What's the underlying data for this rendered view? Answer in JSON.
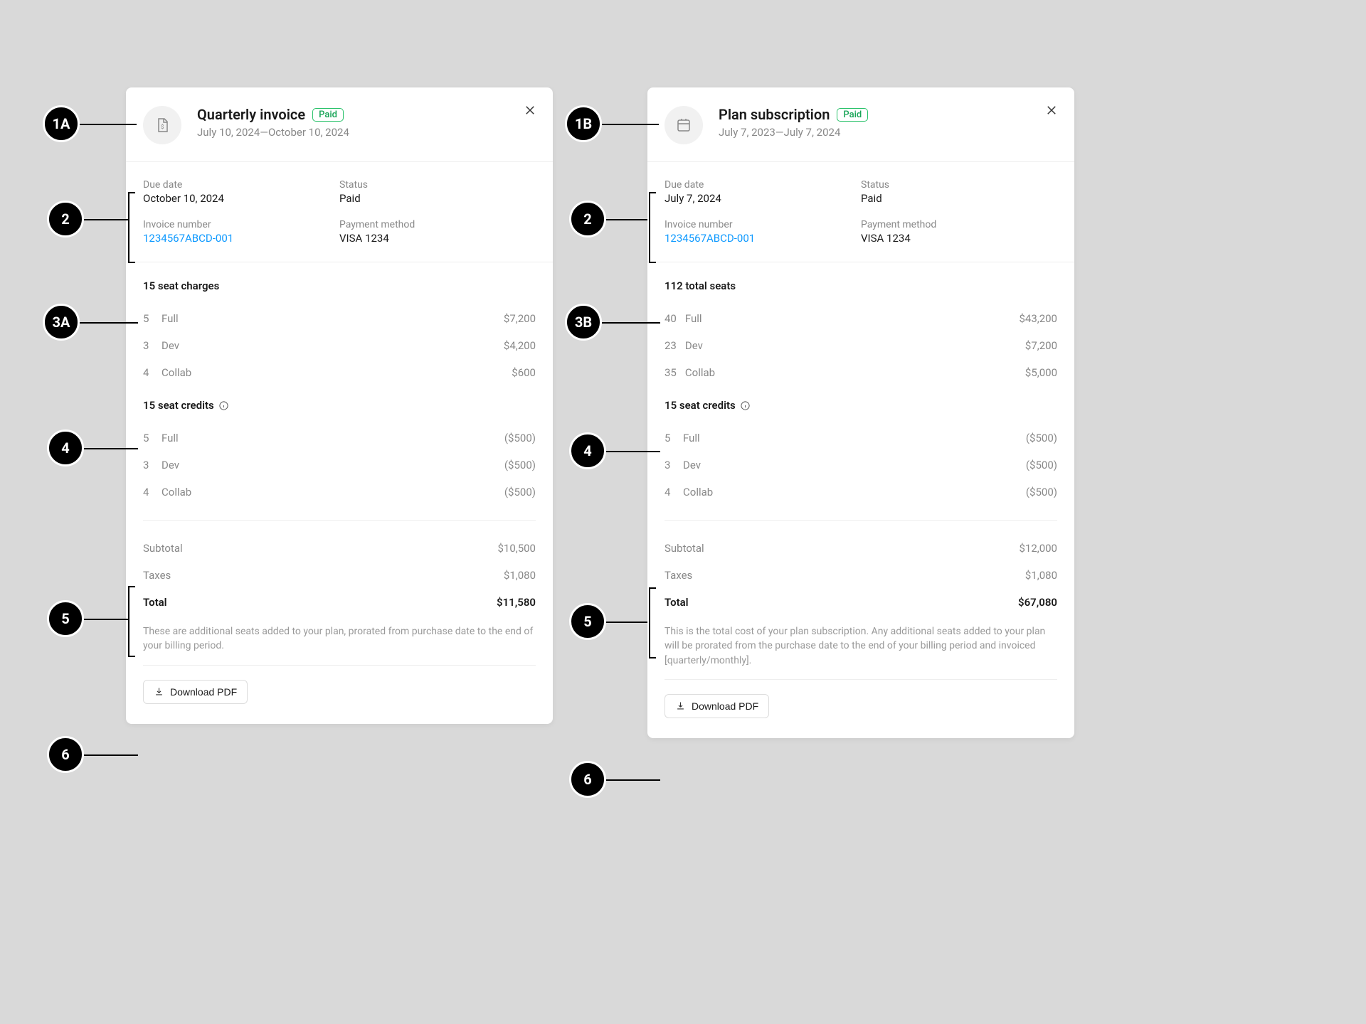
{
  "annotations": {
    "a1a": "1A",
    "a1b": "1B",
    "a2": "2",
    "a3a": "3A",
    "a3b": "3B",
    "a4": "4",
    "a5": "5",
    "a6": "6"
  },
  "left": {
    "title": "Quarterly invoice",
    "badge": "Paid",
    "date_range": "July 10, 2024—October 10, 2024",
    "meta": {
      "due_date_label": "Due date",
      "due_date": "October 10, 2024",
      "status_label": "Status",
      "status": "Paid",
      "invoice_no_label": "Invoice number",
      "invoice_no": "1234567ABCD-001",
      "payment_label": "Payment method",
      "payment": "VISA 1234"
    },
    "charges_title": "15 seat charges",
    "charges": [
      {
        "qty": "5",
        "name": "Full",
        "amount": "$7,200"
      },
      {
        "qty": "3",
        "name": "Dev",
        "amount": "$4,200"
      },
      {
        "qty": "4",
        "name": "Collab",
        "amount": "$600"
      }
    ],
    "credits_title": "15 seat credits",
    "credits": [
      {
        "qty": "5",
        "name": "Full",
        "amount": "($500)"
      },
      {
        "qty": "3",
        "name": "Dev",
        "amount": "($500)"
      },
      {
        "qty": "4",
        "name": "Collab",
        "amount": "($500)"
      }
    ],
    "totals": {
      "subtotal_label": "Subtotal",
      "subtotal": "$10,500",
      "taxes_label": "Taxes",
      "taxes": "$1,080",
      "total_label": "Total",
      "total": "$11,580"
    },
    "note": "These are additional seats added to your plan, prorated from purchase date to the end of your billing period.",
    "download_label": "Download PDF"
  },
  "right": {
    "title": "Plan subscription",
    "badge": "Paid",
    "date_range": "July 7, 2023—July 7, 2024",
    "meta": {
      "due_date_label": "Due date",
      "due_date": "July 7, 2024",
      "status_label": "Status",
      "status": "Paid",
      "invoice_no_label": "Invoice number",
      "invoice_no": "1234567ABCD-001",
      "payment_label": "Payment method",
      "payment": "VISA 1234"
    },
    "charges_title": "112 total seats",
    "charges": [
      {
        "qty": "40",
        "name": "Full",
        "amount": "$43,200"
      },
      {
        "qty": "23",
        "name": "Dev",
        "amount": "$7,200"
      },
      {
        "qty": "35",
        "name": "Collab",
        "amount": "$5,000"
      }
    ],
    "credits_title": "15 seat credits",
    "credits": [
      {
        "qty": "5",
        "name": "Full",
        "amount": "($500)"
      },
      {
        "qty": "3",
        "name": "Dev",
        "amount": "($500)"
      },
      {
        "qty": "4",
        "name": "Collab",
        "amount": "($500)"
      }
    ],
    "totals": {
      "subtotal_label": "Subtotal",
      "subtotal": "$12,000",
      "taxes_label": "Taxes",
      "taxes": "$1,080",
      "total_label": "Total",
      "total": "$67,080"
    },
    "note": "This is the total cost of your plan subscription. Any additional seats added to your plan will be prorated from the purchase date to the end of your billing period and invoiced [quarterly/monthly].",
    "download_label": "Download PDF"
  }
}
